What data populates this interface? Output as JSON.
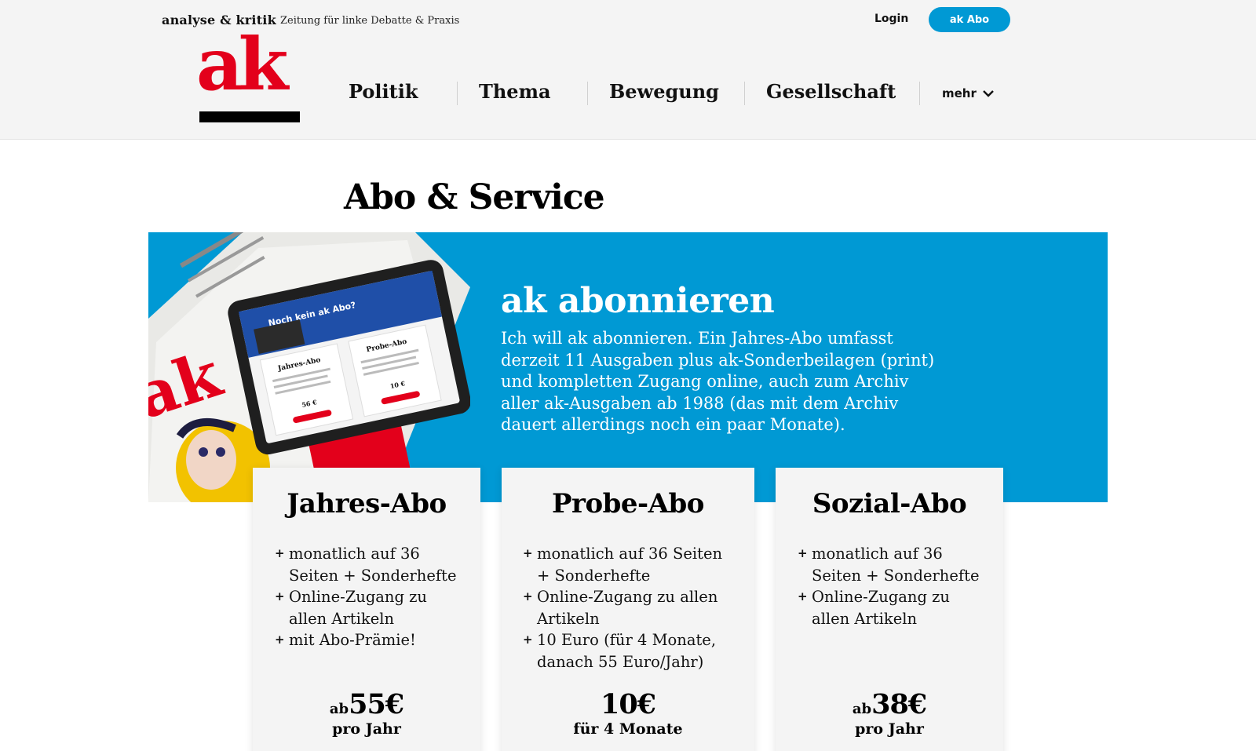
{
  "header": {
    "brand": "analyse & kritik",
    "tagline": "Zeitung für linke Debatte & Praxis",
    "login": "Login",
    "abo_button": "ak Abo",
    "logo_text": "ak",
    "nav": [
      "Politik",
      "Thema",
      "Bewegung",
      "Gesellschaft"
    ],
    "more": "mehr"
  },
  "page_title": "Abo & Service",
  "hero": {
    "heading": "ak abonnieren",
    "text": "Ich will ak abonnieren. Ein Jahres-Abo umfasst derzeit 11 Ausgaben plus ak-Sonderbeilagen (print) und kompletten Zugang online, auch zum Archiv aller ak-Ausgaben ab 1988 (das mit dem Archiv dauert allerdings noch ein paar Monate).",
    "image_texts": {
      "tablet_headline": "Noch kein ak Abo?",
      "card1": "Jahres-Abo",
      "card2": "Probe-Abo",
      "price1": "56 €",
      "price2": "10 €"
    }
  },
  "cards": [
    {
      "title": "Jahres-Abo",
      "features": [
        "monatlich auf 36 Seiten + Sonderhefte",
        "Online-Zugang zu allen Artikeln",
        "mit Abo-Prämie!"
      ],
      "price_prefix": "ab",
      "price": "55€",
      "period": "pro Jahr"
    },
    {
      "title": "Probe-Abo",
      "features": [
        "monatlich auf 36 Seiten + Sonderhefte",
        "Online-Zugang zu allen Artikeln",
        "10 Euro (für 4 Monate, danach 55 Euro/Jahr)"
      ],
      "price_prefix": "",
      "price": "10€",
      "period": "für 4 Monate"
    },
    {
      "title": "Sozial-Abo",
      "features": [
        "monatlich auf 36 Seiten + Sonderhefte",
        "Online-Zugang zu allen Artikeln"
      ],
      "price_prefix": "ab",
      "price": "38€",
      "period": "pro Jahr"
    }
  ],
  "colors": {
    "accent": "#0099d4",
    "brand_red": "#e3001b",
    "header_bg": "#f4f4f4"
  }
}
